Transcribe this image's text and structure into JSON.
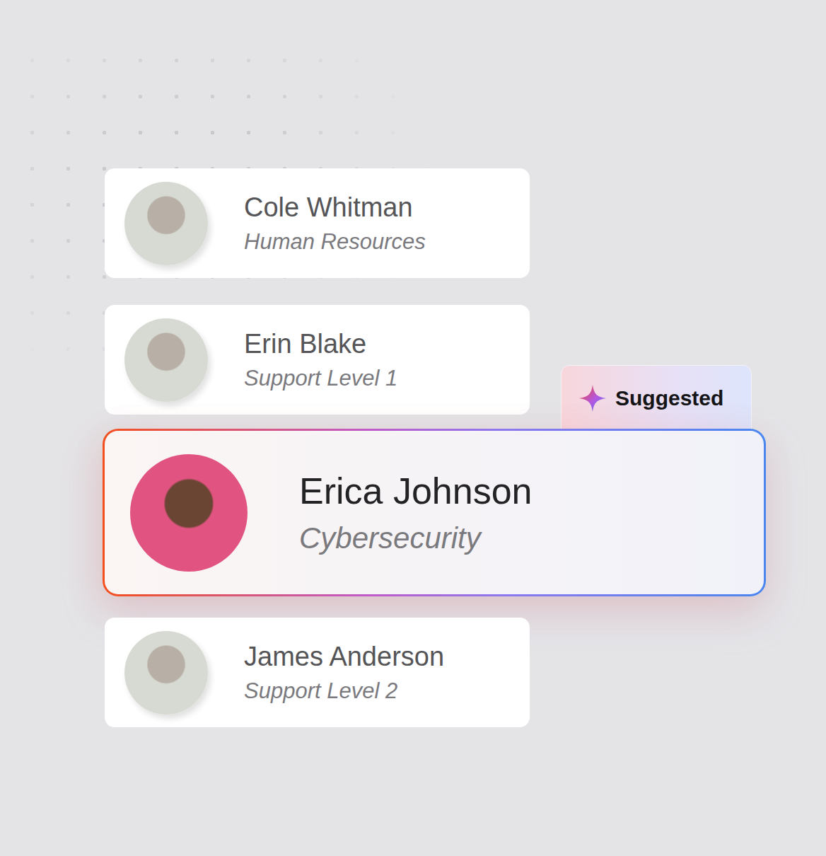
{
  "people": [
    {
      "name": "Cole Whitman",
      "department": "Human Resources",
      "suggested": false
    },
    {
      "name": "Erin Blake",
      "department": "Support Level 1",
      "suggested": false
    },
    {
      "name": "Erica Johnson",
      "department": "Cybersecurity",
      "suggested": true
    },
    {
      "name": "James Anderson",
      "department": "Support Level 2",
      "suggested": false
    }
  ],
  "badge": {
    "label": "Suggested"
  }
}
